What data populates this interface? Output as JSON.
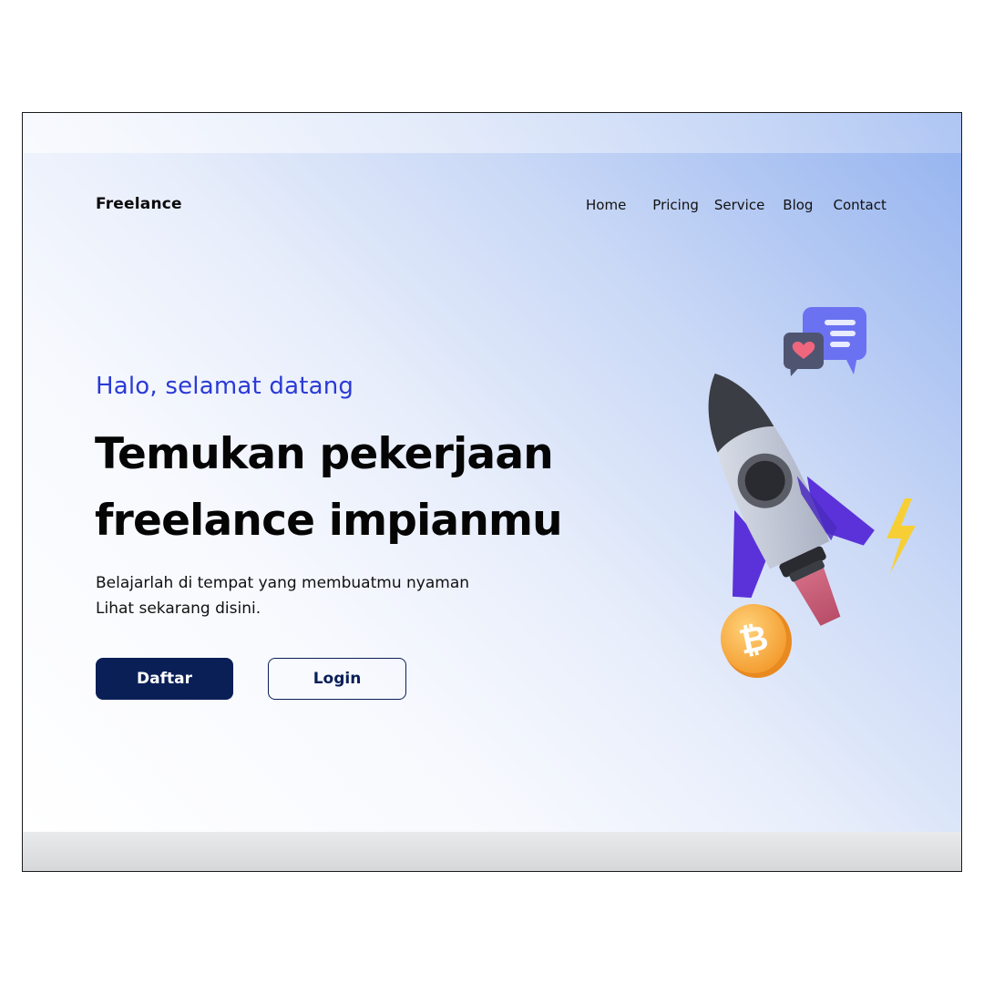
{
  "brand": {
    "logo_text": "Freelance"
  },
  "nav": {
    "items": [
      {
        "label": "Home"
      },
      {
        "label": "Pricing"
      },
      {
        "label": "Service"
      },
      {
        "label": "Blog"
      },
      {
        "label": "Contact"
      }
    ]
  },
  "hero": {
    "greeting": "Halo, selamat datang",
    "headline_line1": "Temukan pekerjaan",
    "headline_line2": "freelance impianmu",
    "description_line1": "Belajarlah di tempat yang membuatmu nyaman",
    "description_line2": "Lihat sekarang disini.",
    "primary_button": "Daftar",
    "secondary_button": "Login"
  },
  "illustration": {
    "icons": [
      "rocket-icon",
      "chat-bubble-icon",
      "heart-icon",
      "bitcoin-coin-icon",
      "lightning-icon"
    ]
  },
  "colors": {
    "accent_blue": "#2b3ad6",
    "primary_navy": "#0b1f57",
    "gradient_blue": "#93b2ef",
    "rocket_purple": "#5b32d9"
  }
}
